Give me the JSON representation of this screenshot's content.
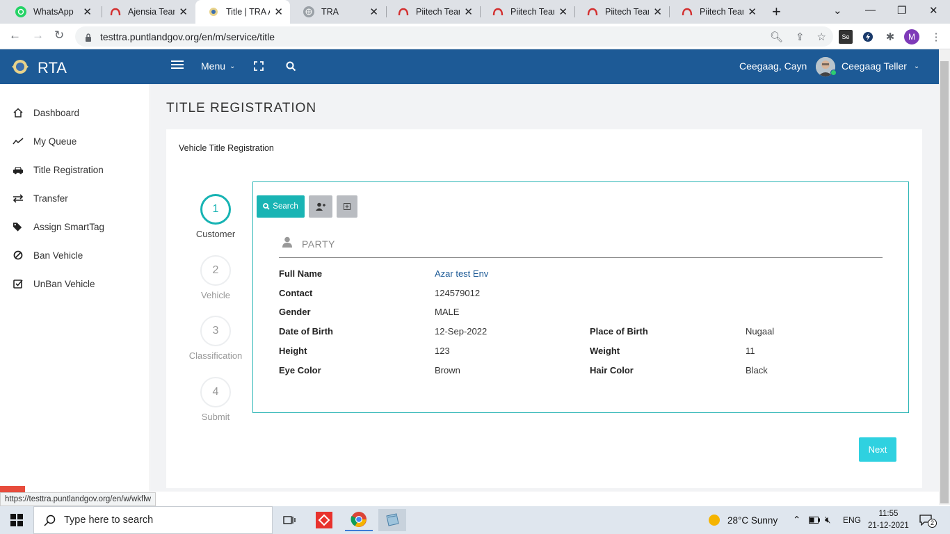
{
  "browser": {
    "tabs": [
      {
        "title": "WhatsApp",
        "icon": "whatsapp-icon"
      },
      {
        "title": "Ajensia Teams",
        "icon": "teams-red-icon"
      },
      {
        "title": "Title | TRA Ap",
        "icon": "rta-logo-icon"
      },
      {
        "title": "TRA",
        "icon": "globe-icon"
      },
      {
        "title": "Piitech Teams",
        "icon": "teams-red-icon"
      },
      {
        "title": "Piitech Teams",
        "icon": "teams-red-icon"
      },
      {
        "title": "Piitech Teams",
        "icon": "teams-red-icon"
      },
      {
        "title": "Piitech Teams",
        "icon": "teams-red-icon"
      }
    ],
    "url": "testtra.puntlandgov.org/en/m/service/title",
    "profile_initial": "M",
    "status_url": "https://testtra.puntlandgov.org/en/w/wkflw"
  },
  "header": {
    "brand": "RTA",
    "menu_label": "Menu",
    "user_name": "Ceegaag, Cayn",
    "role_label": "Ceegaag Teller"
  },
  "sidebar": {
    "items": [
      {
        "label": "Dashboard",
        "icon": "home-icon"
      },
      {
        "label": "My Queue",
        "icon": "trend-icon"
      },
      {
        "label": "Title Registration",
        "icon": "car-icon"
      },
      {
        "label": "Transfer",
        "icon": "exchange-icon"
      },
      {
        "label": "Assign SmartTag",
        "icon": "tags-icon"
      },
      {
        "label": "Ban Vehicle",
        "icon": "ban-icon"
      },
      {
        "label": "UnBan Vehicle",
        "icon": "check-square-icon"
      }
    ]
  },
  "page": {
    "title": "TITLE REGISTRATION",
    "card_title": "Vehicle Title Registration",
    "steps": [
      {
        "num": "1",
        "label": "Customer"
      },
      {
        "num": "2",
        "label": "Vehicle"
      },
      {
        "num": "3",
        "label": "Classification"
      },
      {
        "num": "4",
        "label": "Submit"
      }
    ],
    "search_label": "Search",
    "party_title": "PARTY",
    "fields": {
      "full_name_label": "Full Name",
      "full_name": "Azar test Env",
      "contact_label": "Contact",
      "contact": "124579012",
      "gender_label": "Gender",
      "gender": "MALE",
      "dob_label": "Date of Birth",
      "dob": "12-Sep-2022",
      "pob_label": "Place of Birth",
      "pob": "Nugaal",
      "height_label": "Height",
      "height": "123",
      "weight_label": "Weight",
      "weight": "11",
      "eye_label": "Eye Color",
      "eye": "Brown",
      "hair_label": "Hair Color",
      "hair": "Black"
    },
    "next_label": "Next"
  },
  "taskbar": {
    "search_placeholder": "Type here to search",
    "weather": "28°C  Sunny",
    "lang": "ENG",
    "time": "11:55",
    "date": "21-12-2021",
    "notifications": "2"
  },
  "colors": {
    "header_bg": "#1d5a96",
    "accent_teal": "#19b4b4",
    "next_btn": "#2fd1e0"
  }
}
